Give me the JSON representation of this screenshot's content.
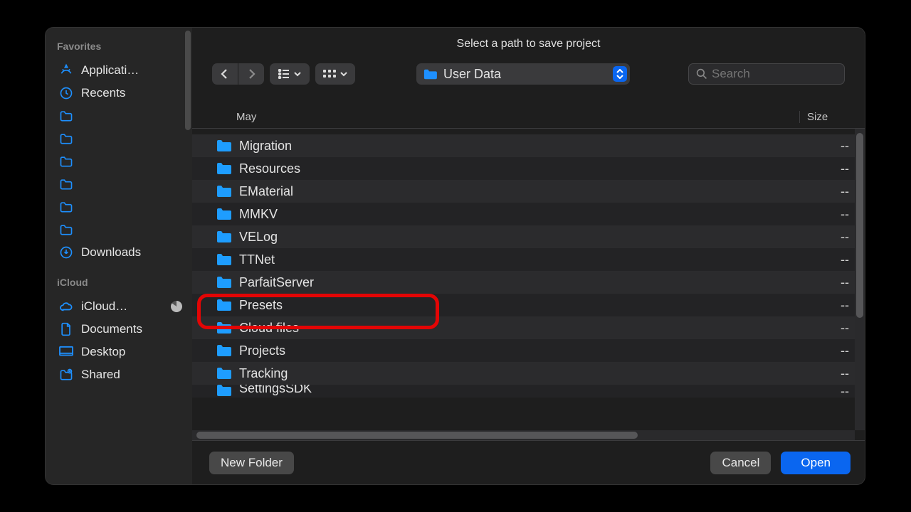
{
  "title": "Select a path to save project",
  "path": {
    "current": "User Data"
  },
  "search": {
    "placeholder": "Search"
  },
  "columns": {
    "date": "May",
    "size": "Size"
  },
  "sidebar": {
    "favorites_header": "Favorites",
    "items": [
      {
        "label": "Applicati…",
        "icon": "apps"
      },
      {
        "label": "Recents",
        "icon": "clock"
      },
      {
        "label": "",
        "icon": "folder"
      },
      {
        "label": "",
        "icon": "folder"
      },
      {
        "label": "",
        "icon": "folder"
      },
      {
        "label": "",
        "icon": "folder"
      },
      {
        "label": "",
        "icon": "folder"
      },
      {
        "label": "",
        "icon": "folder"
      },
      {
        "label": "Downloads",
        "icon": "download"
      }
    ],
    "icloud_header": "iCloud",
    "icloud_items": [
      {
        "label": "iCloud…",
        "icon": "cloud",
        "progress": true
      },
      {
        "label": "Documents",
        "icon": "doc"
      },
      {
        "label": "Desktop",
        "icon": "desktop"
      },
      {
        "label": "Shared",
        "icon": "shared"
      }
    ]
  },
  "rows": [
    {
      "name": "Migration",
      "size": "--"
    },
    {
      "name": "Resources",
      "size": "--"
    },
    {
      "name": "EMaterial",
      "size": "--"
    },
    {
      "name": "MMKV",
      "size": "--"
    },
    {
      "name": "VELog",
      "size": "--"
    },
    {
      "name": "TTNet",
      "size": "--"
    },
    {
      "name": "ParfaitServer",
      "size": "--"
    },
    {
      "name": "Presets",
      "size": "--",
      "highlight": true
    },
    {
      "name": "Cloud files",
      "size": "--"
    },
    {
      "name": "Projects",
      "size": "--"
    },
    {
      "name": "Tracking",
      "size": "--"
    },
    {
      "name": "SettingsSDK",
      "size": "--",
      "partial": true
    }
  ],
  "buttons": {
    "new_folder": "New Folder",
    "cancel": "Cancel",
    "open": "Open"
  }
}
